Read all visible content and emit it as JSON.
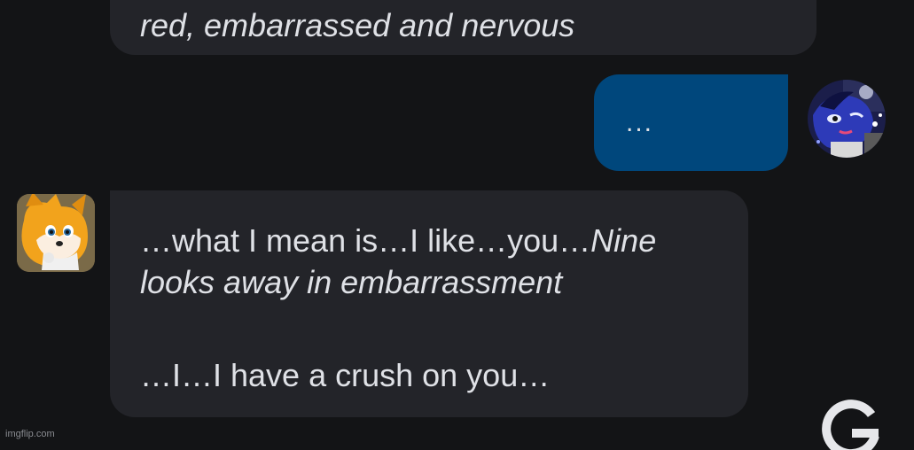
{
  "messages": {
    "previous": {
      "text": "red, embarrassed and nervous"
    },
    "user": {
      "text": "..."
    },
    "bot": {
      "line1_plain": "…what I mean is…I like…you…",
      "line1_italic": "Nine",
      "line2_italic": "looks away in embarrassment",
      "line3_plain": "…I…I have a crush on you…"
    }
  },
  "avatars": {
    "user": "user-avatar",
    "bot": "bot-avatar"
  },
  "watermark": "imgflip.com",
  "icons": {
    "corner": "google-g-icon"
  },
  "colors": {
    "background": "#131416",
    "bot_bubble": "#232429",
    "user_bubble": "#00477c",
    "text": "#dfe1e6"
  }
}
